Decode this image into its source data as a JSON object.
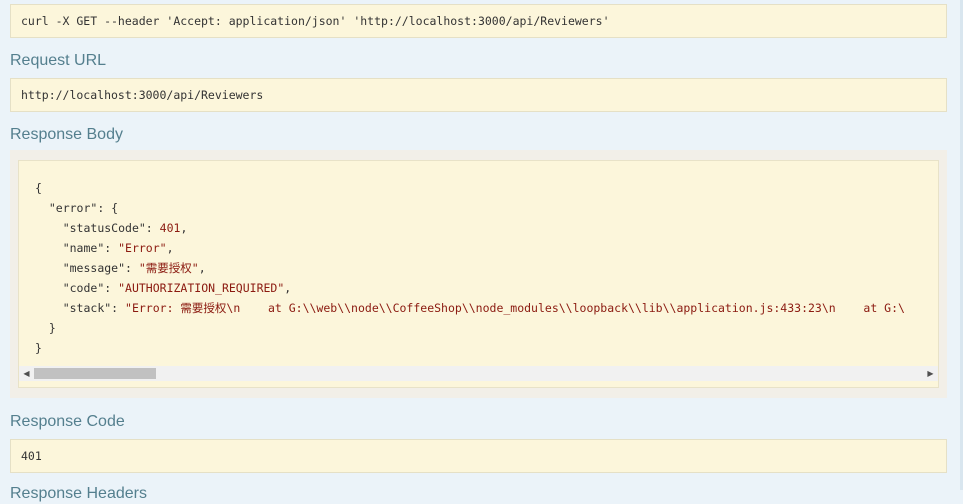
{
  "curl": {
    "command": "curl -X GET --header 'Accept: application/json' 'http://localhost:3000/api/Reviewers'"
  },
  "request_url": {
    "heading": "Request URL",
    "value": "http://localhost:3000/api/Reviewers"
  },
  "response_body": {
    "heading": "Response Body",
    "lines": {
      "open_brace": "{",
      "error_key": "\"error\"",
      "error_open": ": {",
      "status_key": "\"statusCode\"",
      "status_sep": ": ",
      "status_val": "401",
      "status_comma": ",",
      "name_key": "\"name\"",
      "name_sep": ": ",
      "name_val": "\"Error\"",
      "name_comma": ",",
      "message_key": "\"message\"",
      "message_sep": ": ",
      "message_val": "\"需要授权\"",
      "message_comma": ",",
      "code_key": "\"code\"",
      "code_sep": ": ",
      "code_val": "\"AUTHORIZATION_REQUIRED\"",
      "code_comma": ",",
      "stack_key": "\"stack\"",
      "stack_sep": ": ",
      "stack_val": "\"Error: 需要授权\\n    at G:\\\\web\\\\node\\\\CoffeeShop\\\\node_modules\\\\loopback\\\\lib\\\\application.js:433:23\\n    at G:\\",
      "inner_close": "}",
      "outer_close": "}"
    },
    "scrollbar": {
      "left_arrow": "◀",
      "right_arrow": "▶"
    }
  },
  "response_code": {
    "heading": "Response Code",
    "value": "401"
  },
  "response_headers": {
    "heading": "Response Headers"
  }
}
